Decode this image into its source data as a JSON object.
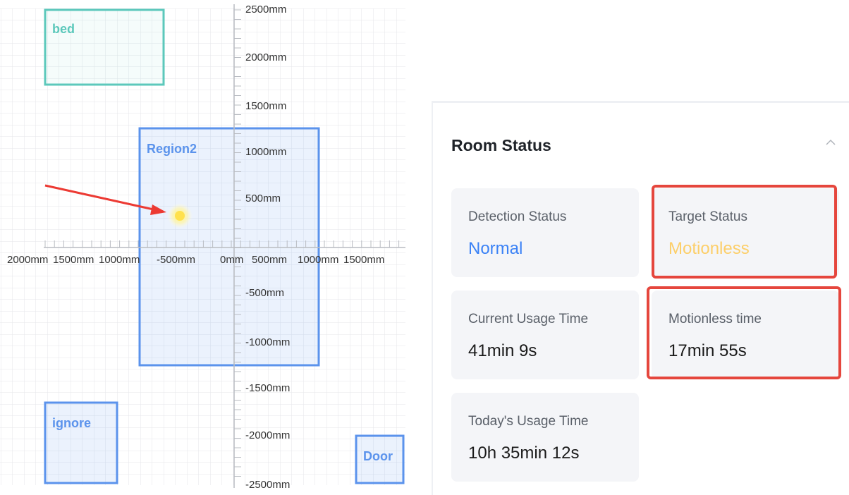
{
  "plot": {
    "x_ticks": [
      "2000mm",
      "1500mm",
      "1000mm",
      "-500mm",
      "0mm",
      "500mm",
      "1000mm",
      "1500mm"
    ],
    "y_ticks": [
      "2500mm",
      "2000mm",
      "1500mm",
      "1000mm",
      "500mm",
      "-500mm",
      "-1000mm",
      "-1500mm",
      "-2000mm",
      "-2500mm"
    ],
    "regions": {
      "bed": "bed",
      "region2": "Region2",
      "ignore": "ignore",
      "door": "Door"
    },
    "colors": {
      "bed": "#5cc8bb",
      "region": "#5b93ec",
      "target": "#ffe14d",
      "arrow": "#ec3a33"
    }
  },
  "room_status": {
    "title": "Room Status",
    "cards": {
      "detection": {
        "label": "Detection Status",
        "value": "Normal"
      },
      "target": {
        "label": "Target Status",
        "value": "Motionless"
      },
      "current_usage": {
        "label": "Current Usage Time",
        "value": "41min 9s"
      },
      "motionless_time": {
        "label": "Motionless time",
        "value": "17min 55s"
      },
      "today_usage": {
        "label": "Today's Usage Time",
        "value": "10h 35min 12s"
      }
    }
  }
}
